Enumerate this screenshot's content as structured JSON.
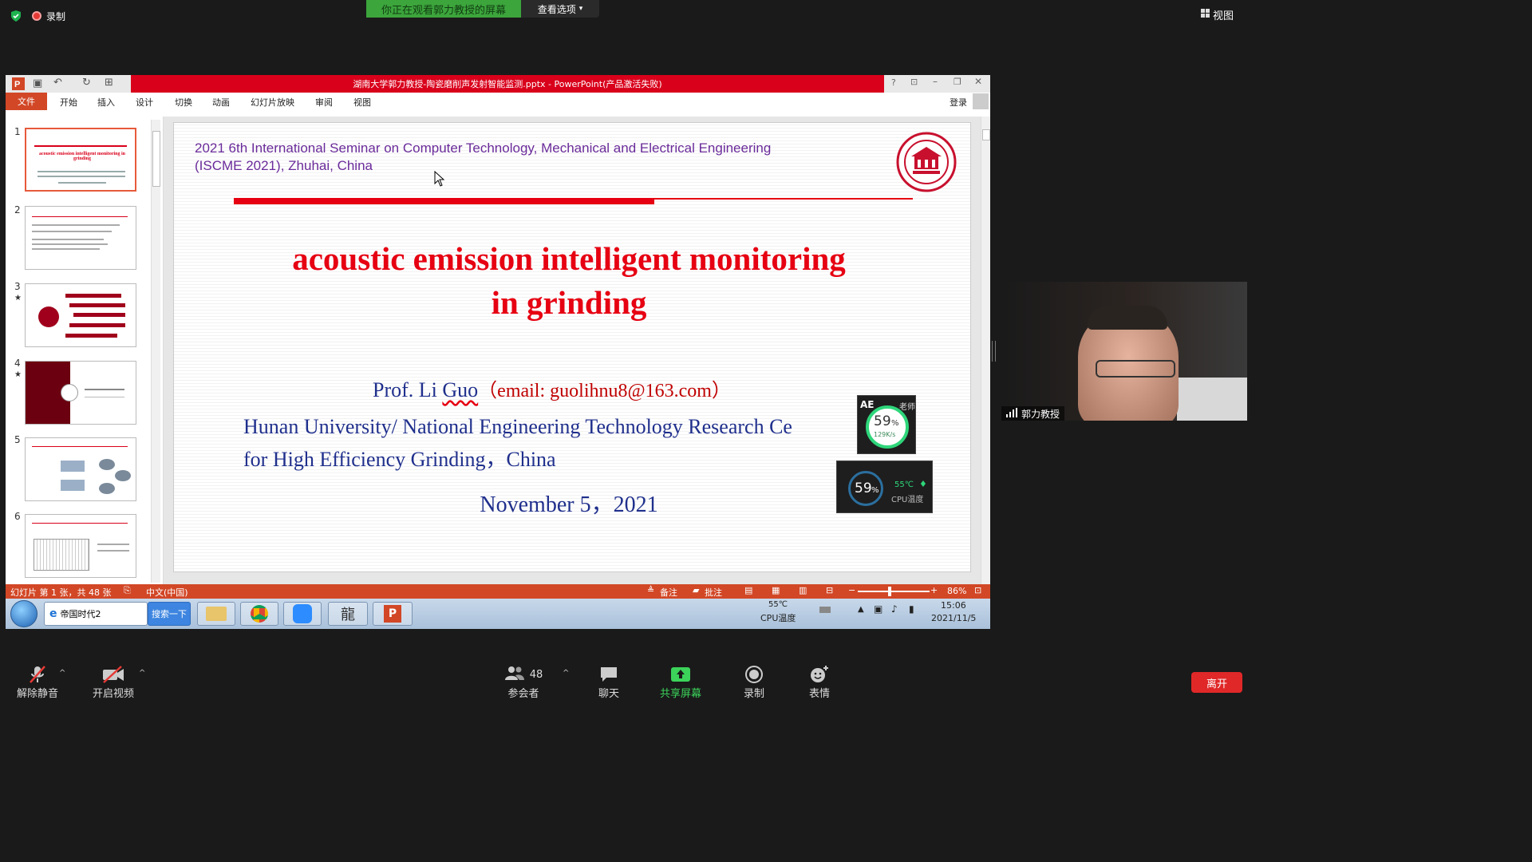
{
  "zoom": {
    "record_label": "录制",
    "banner_text": "你正在观看郭力教授的屏幕",
    "view_options_label": "查看选项",
    "view_label": "视图",
    "participant_name": "郭力教授",
    "controls": {
      "unmute": "解除静音",
      "start_video": "开启视频",
      "participants": "参会者",
      "participants_count": "48",
      "chat": "聊天",
      "share": "共享屏幕",
      "record": "录制",
      "reactions": "表情",
      "leave": "离开"
    }
  },
  "powerpoint": {
    "window_title": "湖南大学郭力教授-陶瓷磨削声发射智能监测.pptx -  PowerPoint(产品激活失败)",
    "menu": [
      "文件",
      "开始",
      "插入",
      "设计",
      "切换",
      "动画",
      "幻灯片放映",
      "审阅",
      "视图"
    ],
    "login": "登录",
    "thumbnails": [
      {
        "num": "1",
        "star": ""
      },
      {
        "num": "2",
        "star": ""
      },
      {
        "num": "3",
        "star": "★"
      },
      {
        "num": "4",
        "star": "★"
      },
      {
        "num": "5",
        "star": ""
      },
      {
        "num": "6",
        "star": ""
      }
    ],
    "status": {
      "slide_info": "幻灯片 第 1 张，共 48 张",
      "language": "中文(中国)",
      "notes": "备注",
      "comments": "批注",
      "zoom": "86%"
    }
  },
  "slide": {
    "seminar_line1": "2021 6th International Seminar on Computer Technology, Mechanical and Electrical Engineering",
    "seminar_line2": "(ISCME 2021), Zhuhai, China",
    "title_line1": "acoustic emission intelligent monitoring",
    "title_line2": "in grinding",
    "author_prefix": "Prof.  Li ",
    "author_name": "Guo",
    "author_email": "（email: guolihnu8@163.com）",
    "affiliation_line1": "Hunan University/ National Engineering Technology Research Ce",
    "affiliation_line2": "for High Efficiency Grinding，China",
    "date": "November 5，2021"
  },
  "widgets": {
    "ae_label": "AE",
    "ae_suffix": "老师",
    "percent_small": "59",
    "speed": "129K/s",
    "percent_big": "59",
    "temp": "55℃",
    "temp_label": "CPU温度"
  },
  "taskbar": {
    "ie_label": "帝国时代2",
    "search_btn": "搜索一下",
    "temp": "55℃",
    "temp_label": "CPU温度",
    "time": "15:06",
    "date": "2021/11/5"
  },
  "colors": {
    "ppt_red": "#d9001b",
    "ppt_orange": "#d24726",
    "title_red": "#e60012",
    "navy": "#1f2f8c",
    "purple": "#6a2b9a",
    "zoom_green": "#3ca53c"
  }
}
